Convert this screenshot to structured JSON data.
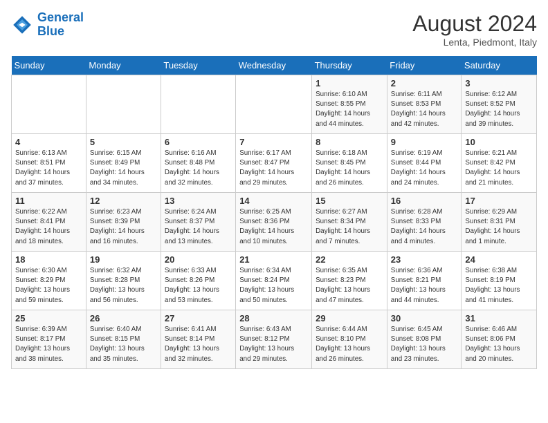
{
  "header": {
    "logo_line1": "General",
    "logo_line2": "Blue",
    "month_year": "August 2024",
    "location": "Lenta, Piedmont, Italy"
  },
  "weekdays": [
    "Sunday",
    "Monday",
    "Tuesday",
    "Wednesday",
    "Thursday",
    "Friday",
    "Saturday"
  ],
  "weeks": [
    [
      {
        "day": "",
        "info": ""
      },
      {
        "day": "",
        "info": ""
      },
      {
        "day": "",
        "info": ""
      },
      {
        "day": "",
        "info": ""
      },
      {
        "day": "1",
        "info": "Sunrise: 6:10 AM\nSunset: 8:55 PM\nDaylight: 14 hours\nand 44 minutes."
      },
      {
        "day": "2",
        "info": "Sunrise: 6:11 AM\nSunset: 8:53 PM\nDaylight: 14 hours\nand 42 minutes."
      },
      {
        "day": "3",
        "info": "Sunrise: 6:12 AM\nSunset: 8:52 PM\nDaylight: 14 hours\nand 39 minutes."
      }
    ],
    [
      {
        "day": "4",
        "info": "Sunrise: 6:13 AM\nSunset: 8:51 PM\nDaylight: 14 hours\nand 37 minutes."
      },
      {
        "day": "5",
        "info": "Sunrise: 6:15 AM\nSunset: 8:49 PM\nDaylight: 14 hours\nand 34 minutes."
      },
      {
        "day": "6",
        "info": "Sunrise: 6:16 AM\nSunset: 8:48 PM\nDaylight: 14 hours\nand 32 minutes."
      },
      {
        "day": "7",
        "info": "Sunrise: 6:17 AM\nSunset: 8:47 PM\nDaylight: 14 hours\nand 29 minutes."
      },
      {
        "day": "8",
        "info": "Sunrise: 6:18 AM\nSunset: 8:45 PM\nDaylight: 14 hours\nand 26 minutes."
      },
      {
        "day": "9",
        "info": "Sunrise: 6:19 AM\nSunset: 8:44 PM\nDaylight: 14 hours\nand 24 minutes."
      },
      {
        "day": "10",
        "info": "Sunrise: 6:21 AM\nSunset: 8:42 PM\nDaylight: 14 hours\nand 21 minutes."
      }
    ],
    [
      {
        "day": "11",
        "info": "Sunrise: 6:22 AM\nSunset: 8:41 PM\nDaylight: 14 hours\nand 18 minutes."
      },
      {
        "day": "12",
        "info": "Sunrise: 6:23 AM\nSunset: 8:39 PM\nDaylight: 14 hours\nand 16 minutes."
      },
      {
        "day": "13",
        "info": "Sunrise: 6:24 AM\nSunset: 8:37 PM\nDaylight: 14 hours\nand 13 minutes."
      },
      {
        "day": "14",
        "info": "Sunrise: 6:25 AM\nSunset: 8:36 PM\nDaylight: 14 hours\nand 10 minutes."
      },
      {
        "day": "15",
        "info": "Sunrise: 6:27 AM\nSunset: 8:34 PM\nDaylight: 14 hours\nand 7 minutes."
      },
      {
        "day": "16",
        "info": "Sunrise: 6:28 AM\nSunset: 8:33 PM\nDaylight: 14 hours\nand 4 minutes."
      },
      {
        "day": "17",
        "info": "Sunrise: 6:29 AM\nSunset: 8:31 PM\nDaylight: 14 hours\nand 1 minute."
      }
    ],
    [
      {
        "day": "18",
        "info": "Sunrise: 6:30 AM\nSunset: 8:29 PM\nDaylight: 13 hours\nand 59 minutes."
      },
      {
        "day": "19",
        "info": "Sunrise: 6:32 AM\nSunset: 8:28 PM\nDaylight: 13 hours\nand 56 minutes."
      },
      {
        "day": "20",
        "info": "Sunrise: 6:33 AM\nSunset: 8:26 PM\nDaylight: 13 hours\nand 53 minutes."
      },
      {
        "day": "21",
        "info": "Sunrise: 6:34 AM\nSunset: 8:24 PM\nDaylight: 13 hours\nand 50 minutes."
      },
      {
        "day": "22",
        "info": "Sunrise: 6:35 AM\nSunset: 8:23 PM\nDaylight: 13 hours\nand 47 minutes."
      },
      {
        "day": "23",
        "info": "Sunrise: 6:36 AM\nSunset: 8:21 PM\nDaylight: 13 hours\nand 44 minutes."
      },
      {
        "day": "24",
        "info": "Sunrise: 6:38 AM\nSunset: 8:19 PM\nDaylight: 13 hours\nand 41 minutes."
      }
    ],
    [
      {
        "day": "25",
        "info": "Sunrise: 6:39 AM\nSunset: 8:17 PM\nDaylight: 13 hours\nand 38 minutes."
      },
      {
        "day": "26",
        "info": "Sunrise: 6:40 AM\nSunset: 8:15 PM\nDaylight: 13 hours\nand 35 minutes."
      },
      {
        "day": "27",
        "info": "Sunrise: 6:41 AM\nSunset: 8:14 PM\nDaylight: 13 hours\nand 32 minutes."
      },
      {
        "day": "28",
        "info": "Sunrise: 6:43 AM\nSunset: 8:12 PM\nDaylight: 13 hours\nand 29 minutes."
      },
      {
        "day": "29",
        "info": "Sunrise: 6:44 AM\nSunset: 8:10 PM\nDaylight: 13 hours\nand 26 minutes."
      },
      {
        "day": "30",
        "info": "Sunrise: 6:45 AM\nSunset: 8:08 PM\nDaylight: 13 hours\nand 23 minutes."
      },
      {
        "day": "31",
        "info": "Sunrise: 6:46 AM\nSunset: 8:06 PM\nDaylight: 13 hours\nand 20 minutes."
      }
    ]
  ]
}
